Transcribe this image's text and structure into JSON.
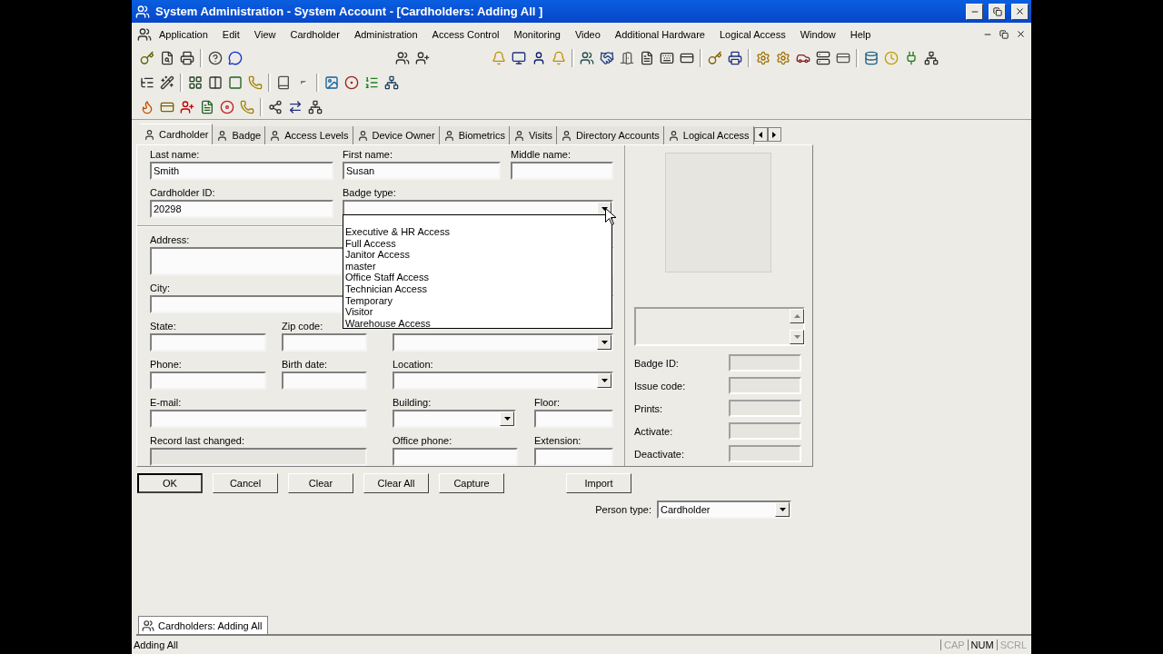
{
  "window": {
    "title": "System Administration - System Account - [Cardholders: Adding All ]"
  },
  "menu": [
    "Application",
    "Edit",
    "View",
    "Cardholder",
    "Administration",
    "Access Control",
    "Monitoring",
    "Video",
    "Additional Hardware",
    "Logical Access",
    "Window",
    "Help"
  ],
  "tabs": [
    {
      "label": "Cardholder",
      "selected": true
    },
    {
      "label": "Badge",
      "selected": false
    },
    {
      "label": "Access Levels",
      "selected": false
    },
    {
      "label": "Device Owner",
      "selected": false
    },
    {
      "label": "Biometrics",
      "selected": false
    },
    {
      "label": "Visits",
      "selected": false
    },
    {
      "label": "Directory Accounts",
      "selected": false
    },
    {
      "label": "Logical Access",
      "selected": false
    }
  ],
  "form": {
    "rows": [
      [
        {
          "label": "Last name:",
          "value": "Smith",
          "kind": "text",
          "disabled": false
        },
        {
          "label": "First name:",
          "value": "Susan",
          "kind": "text",
          "disabled": false
        },
        {
          "label": "Middle name:",
          "kind": "text",
          "disabled": false
        }
      ],
      [
        {
          "label": "Cardholder ID:",
          "value": "20298",
          "kind": "text",
          "disabled": false
        },
        {
          "label": "Badge type:",
          "kind": "combo",
          "disabled": false
        }
      ],
      [
        {
          "label": "Address:",
          "kind": "textarea",
          "disabled": false
        }
      ],
      [
        {
          "label": "City:",
          "kind": "text",
          "disabled": false
        }
      ],
      [
        {
          "label": "State:",
          "kind": "text",
          "disabled": false
        },
        {
          "label": "Zip code:",
          "kind": "text",
          "disabled": false
        },
        {
          "kind": "combo",
          "disabled": false
        }
      ],
      [
        {
          "label": "Phone:",
          "kind": "text",
          "disabled": false
        },
        {
          "label": "Birth date:",
          "kind": "text",
          "disabled": false
        },
        {
          "label": "Location:",
          "kind": "combo",
          "disabled": false
        }
      ],
      [
        {
          "label": "E-mail:",
          "kind": "text",
          "disabled": false
        },
        {
          "label": "Building:",
          "kind": "combo",
          "disabled": false
        },
        {
          "label": "Floor:",
          "kind": "text",
          "disabled": false
        }
      ],
      [
        {
          "label": "Record last changed:",
          "kind": "text",
          "disabled": true
        },
        {
          "label": "Office phone:",
          "kind": "text",
          "disabled": false
        },
        {
          "label": "Extension:",
          "kind": "text",
          "disabled": false
        }
      ]
    ]
  },
  "badge_type_dropdown": {
    "options": [
      "Executive & HR Access",
      "Full Access",
      "Janitor Access",
      "master",
      "Office Staff Access",
      "Technician Access",
      "Temporary",
      "Visitor",
      "Warehouse Access"
    ]
  },
  "badge_fields": [
    {
      "label": "Badge ID:",
      "disabled": true
    },
    {
      "label": "Issue code:",
      "disabled": true
    },
    {
      "label": "Prints:",
      "disabled": true
    },
    {
      "label": "Activate:",
      "disabled": true
    },
    {
      "label": "Deactivate:",
      "disabled": true
    }
  ],
  "buttons": [
    {
      "label": "OK",
      "default": true
    },
    {
      "label": "Cancel",
      "default": false
    },
    {
      "label": "Clear",
      "default": false
    },
    {
      "label": "Clear All",
      "default": false
    },
    {
      "label": "Capture",
      "default": false
    },
    {
      "label": "Import",
      "default": false
    }
  ],
  "person_type": {
    "label": "Person type:",
    "value": "Cardholder"
  },
  "task_tabs": [
    {
      "label": "Cardholders: Adding All",
      "selected": true
    }
  ],
  "status_bar": {
    "text": "Adding All",
    "indicators": [
      {
        "label": "CAP",
        "on": false
      },
      {
        "label": "NUM",
        "on": true
      },
      {
        "label": "SCRL",
        "on": false
      }
    ]
  }
}
